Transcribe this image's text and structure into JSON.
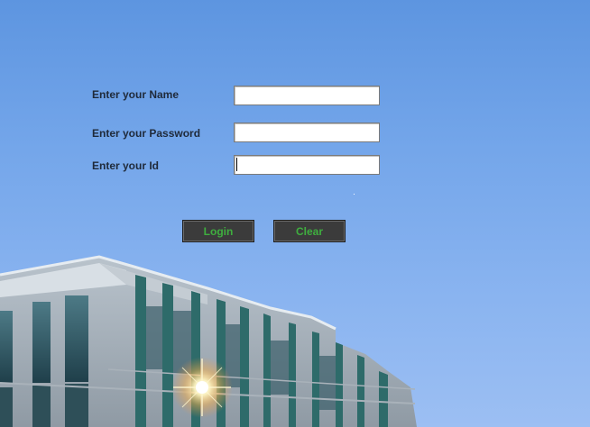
{
  "form": {
    "name_label": "Enter your Name",
    "password_label": "Enter your Password",
    "id_label": "Enter your Id",
    "name_value": "",
    "password_value": "",
    "id_value": "",
    "login_label": "Login",
    "clear_label": "Clear"
  },
  "colors": {
    "button_bg": "#3b3b3b",
    "button_text": "#3fae3f",
    "sky_top": "#5d95e0",
    "sky_bottom": "#9cbff3"
  }
}
